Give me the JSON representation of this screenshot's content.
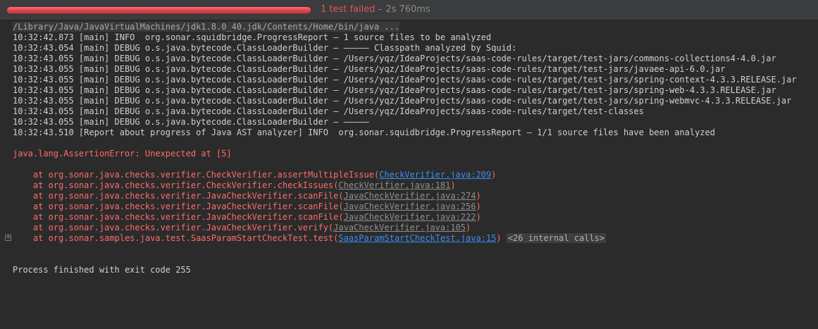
{
  "header": {
    "progress_fraction": 1.0,
    "status_failed": "1 test failed",
    "status_separator": " – ",
    "status_time": "2s 760ms",
    "colors": {
      "failed": "#e5555b",
      "muted": "#8a8a8a"
    }
  },
  "console": {
    "command": "/Library/Java/JavaVirtualMachines/jdk1.8.0_40.jdk/Contents/Home/bin/java ...",
    "log_lines": [
      "10:32:42.873 [main] INFO  org.sonar.squidbridge.ProgressReport – 1 source files to be analyzed",
      "10:32:43.054 [main] DEBUG o.s.java.bytecode.ClassLoaderBuilder – ––––– Classpath analyzed by Squid:",
      "10:32:43.055 [main] DEBUG o.s.java.bytecode.ClassLoaderBuilder – /Users/yqz/IdeaProjects/saas-code-rules/target/test-jars/commons-collections4-4.0.jar",
      "10:32:43.055 [main] DEBUG o.s.java.bytecode.ClassLoaderBuilder – /Users/yqz/IdeaProjects/saas-code-rules/target/test-jars/javaee-api-6.0.jar",
      "10:32:43.055 [main] DEBUG o.s.java.bytecode.ClassLoaderBuilder – /Users/yqz/IdeaProjects/saas-code-rules/target/test-jars/spring-context-4.3.3.RELEASE.jar",
      "10:32:43.055 [main] DEBUG o.s.java.bytecode.ClassLoaderBuilder – /Users/yqz/IdeaProjects/saas-code-rules/target/test-jars/spring-web-4.3.3.RELEASE.jar",
      "10:32:43.055 [main] DEBUG o.s.java.bytecode.ClassLoaderBuilder – /Users/yqz/IdeaProjects/saas-code-rules/target/test-jars/spring-webmvc-4.3.3.RELEASE.jar",
      "10:32:43.055 [main] DEBUG o.s.java.bytecode.ClassLoaderBuilder – /Users/yqz/IdeaProjects/saas-code-rules/target/test-classes",
      "10:32:43.055 [main] DEBUG o.s.java.bytecode.ClassLoaderBuilder – –––––",
      "10:32:43.510 [Report about progress of Java AST analyzer] INFO  org.sonar.squidbridge.ProgressReport – 1/1 source files have been analyzed"
    ],
    "error_line": "java.lang.AssertionError: Unexpected at [5]",
    "stack": [
      {
        "prefix": "    at org.sonar.java.checks.verifier.CheckVerifier.assertMultipleIssue(",
        "link": "CheckVerifier.java:209",
        "link_style": "blue",
        "suffix": ")"
      },
      {
        "prefix": "    at org.sonar.java.checks.verifier.CheckVerifier.checkIssues(",
        "link": "CheckVerifier.java:181",
        "link_style": "gray",
        "suffix": ")"
      },
      {
        "prefix": "    at org.sonar.java.checks.verifier.JavaCheckVerifier.scanFile(",
        "link": "JavaCheckVerifier.java:274",
        "link_style": "gray",
        "suffix": ")"
      },
      {
        "prefix": "    at org.sonar.java.checks.verifier.JavaCheckVerifier.scanFile(",
        "link": "JavaCheckVerifier.java:256",
        "link_style": "gray",
        "suffix": ")"
      },
      {
        "prefix": "    at org.sonar.java.checks.verifier.JavaCheckVerifier.scanFile(",
        "link": "JavaCheckVerifier.java:222",
        "link_style": "gray",
        "suffix": ")"
      },
      {
        "prefix": "    at org.sonar.java.checks.verifier.JavaCheckVerifier.verify(",
        "link": "JavaCheckVerifier.java:105",
        "link_style": "gray",
        "suffix": ")"
      },
      {
        "prefix": "    at org.sonar.samples.java.test.SaasParamStartCheckTest.test(",
        "link": "SaasParamStartCheckTest.java:15",
        "link_style": "blue",
        "suffix": ")",
        "internal": "<26 internal calls>"
      }
    ],
    "exit_line": "Process finished with exit code 255"
  }
}
